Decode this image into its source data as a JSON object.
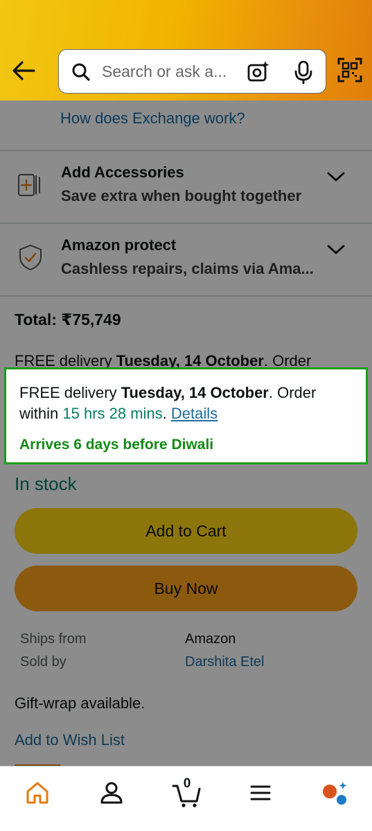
{
  "header": {
    "search_placeholder": "Search or ask a..."
  },
  "exchange": {
    "link_text": "How does Exchange work?"
  },
  "accessories": {
    "title": "Add Accessories",
    "subtitle": "Save extra when bought together"
  },
  "protect": {
    "title": "Amazon protect",
    "subtitle": "Cashless repairs, claims via Ama..."
  },
  "total": {
    "label": "Total: ₹75,749"
  },
  "delivery_behind": {
    "prefix": "FREE delivery ",
    "date": "Tuesday, 14 October",
    "suffix": ". Order"
  },
  "delivery_popup": {
    "prefix": "FREE delivery ",
    "date": "Tuesday, 14 October",
    "suffix": ". Order",
    "within": "within ",
    "countdown": "15 hrs 28 mins",
    "sep": ". ",
    "details_link": "Details",
    "arrives": "Arrives 6 days before Diwali"
  },
  "stock": {
    "status": "In stock"
  },
  "buttons": {
    "add_to_cart": "Add to Cart",
    "buy_now": "Buy Now"
  },
  "seller": {
    "ships_from_label": "Ships from",
    "ships_from_value": "Amazon",
    "sold_by_label": "Sold by",
    "sold_by_value": "Darshita Etel"
  },
  "gift_wrap": "Gift-wrap available.",
  "wish_list": "Add to Wish List",
  "bottom_nav": {
    "cart_count": "0",
    "items": [
      "home-icon",
      "account-icon",
      "cart-icon",
      "menu-icon",
      "rufus-icon"
    ]
  },
  "colors": {
    "accent_link": "#1b6b9f",
    "in_stock": "#067d62",
    "add_to_cart": "#ffd814",
    "buy_now": "#ffa41c",
    "highlight_border": "#1a9e1a"
  }
}
